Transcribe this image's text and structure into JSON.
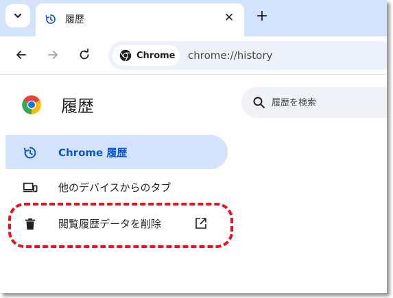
{
  "tab": {
    "title": "履歴",
    "close_glyph": "✕"
  },
  "new_tab_glyph": "+",
  "omnibox": {
    "chip_label": "Chrome",
    "url": "chrome://history"
  },
  "page": {
    "title": "履歴",
    "search_placeholder": "履歴を検索"
  },
  "sidebar": {
    "items": [
      {
        "label": "Chrome 履歴",
        "icon": "history-icon",
        "active": true
      },
      {
        "label": "他のデバイスからのタブ",
        "icon": "devices-icon",
        "active": false
      },
      {
        "label": "閲覧履歴データを削除",
        "icon": "trash-icon",
        "active": false,
        "external": true
      }
    ]
  },
  "colors": {
    "tabstrip": "#d3e3fd",
    "active_nav": "#0b57d0",
    "highlight": "#e8111f"
  }
}
